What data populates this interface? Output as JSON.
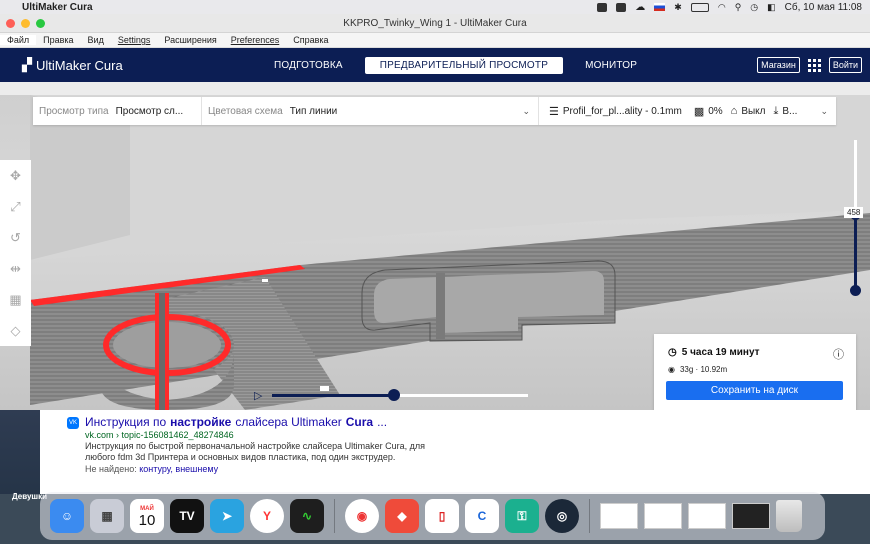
{
  "mac_menubar": {
    "app_name": "UltiMaker Cura",
    "datetime": "Сб, 10 мая  11:08"
  },
  "window": {
    "title": "KKPRO_Twinky_Wing 1 - UltiMaker Cura",
    "menu": [
      "Файл",
      "Правка",
      "Вид",
      "Settings",
      "Расширения",
      "Preferences",
      "Справка"
    ]
  },
  "cura": {
    "logo": "UltiMaker Cura",
    "stages": [
      {
        "label": "ПОДГОТОВКА",
        "active": false
      },
      {
        "label": "ПРЕДВАРИТЕЛЬНЫЙ ПРОСМОТР",
        "active": true
      },
      {
        "label": "МОНИТОР",
        "active": false
      }
    ],
    "marketplace": "Магазин",
    "signin": "Войти",
    "toolbar": {
      "view_type_label": "Просмотр типа",
      "view_type_value": "Просмотр сл...",
      "color_scheme_label": "Цветовая схема",
      "color_scheme_value": "Тип линии",
      "profile": "Profil_for_pl...ality - 0.1mm",
      "infill": "0%",
      "support": "Выкл",
      "adhesion": "В..."
    },
    "layer_number": "458",
    "layer_fraction": 0.5,
    "playback_progress": 0.47,
    "print_info": {
      "time": "5 часа 19 минут",
      "material": "33g · 10.92m",
      "save_button": "Сохранить на диск"
    }
  },
  "browser_result": {
    "title_prefix": "Инструкция по ",
    "title_bold": "настройке",
    "title_mid": " слайсера Ultimaker ",
    "title_bold2": "Cura",
    "title_suffix": "...",
    "url": "vk.com › topic-156081462_48274846",
    "desc": "Инструкция по быстрой первоначальной настройке слайсера Ultimaker Cura, для любого fdm 3d Принтера и основных видов пластика, под один экструдер.",
    "missing_label": "Не найдено:",
    "missing_terms": "контуру, внешнему"
  },
  "desktop_label": "Девушки",
  "dock": {
    "calendar_month": "МАЙ",
    "calendar_day": "10"
  }
}
